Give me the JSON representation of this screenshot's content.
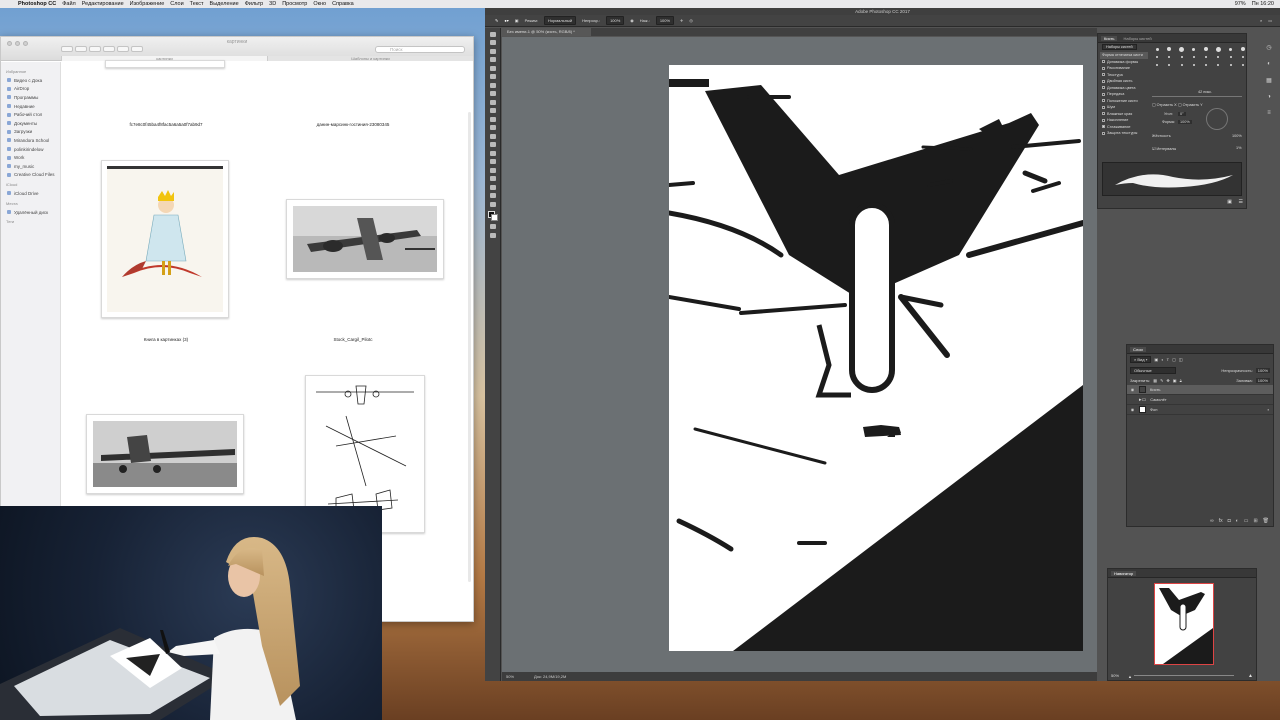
{
  "menubar": {
    "app": "Photoshop CC",
    "items": [
      "Файл",
      "Редактирование",
      "Изображение",
      "Слои",
      "Текст",
      "Выделение",
      "Фильтр",
      "3D",
      "Просмотр",
      "Окно",
      "Справка"
    ],
    "status_right": [
      "97%",
      "Пн 16:20"
    ]
  },
  "finder": {
    "search_placeholder": "Поиск",
    "tabs": [
      "картинки",
      "Шаблоны и картинки"
    ],
    "sidebar": {
      "favorites_label": "Избранное",
      "favorites": [
        "Видео с Дока",
        "AirDrop",
        "Программы",
        "Недавние",
        "Рабочий стол",
        "Документы",
        "Загрузки",
        "Mirandora School",
        "polinkirindelow",
        "Work",
        "my_music",
        "Creative Cloud Files"
      ],
      "icloud_label": "iCloud",
      "icloud": [
        "iCloud Drive"
      ],
      "devices_label": "Места",
      "devices": [
        "Удалённый диск"
      ],
      "tags_label": "Теги"
    },
    "files": [
      {
        "caption": "fc7e8c0f45ba4f8fac5a6a5a0f7ab9d7"
      },
      {
        "caption": "данин-марсинк-гостиния-23080345"
      },
      {
        "caption": "Книга в картинках (3)"
      },
      {
        "caption": "Stock_Cargil_Pilotc"
      }
    ]
  },
  "photoshop": {
    "title": "Adobe Photoshop CC 2017",
    "options": {
      "mode_label": "Режим:",
      "mode_value": "Нормальный",
      "opacity_label": "Непрозр.:",
      "opacity_value": "100%",
      "flow_label": "Наж.:",
      "flow_value": "100%"
    },
    "doc_tab": "Без имени-1 @ 50% (кисть, RGB/8) *",
    "status": {
      "zoom": "50%",
      "doc_size": "Док: 24,9M/19,2M"
    },
    "brush_panel": {
      "tabs": [
        "Кисть",
        "Наборы кистей"
      ],
      "preset_button": "Наборы кистей",
      "options": [
        "Форма отпечатка кисти",
        "Динамика формы",
        "Рассеивание",
        "Текстура",
        "Двойная кисть",
        "Динамика цвета",
        "Передача",
        "Положение кисти",
        "Шум",
        "Влажные края",
        "Накопление",
        "Сглаживание",
        "Защита текстуры"
      ],
      "size_value": "42 пикс.",
      "flip_x": "Отразить X",
      "flip_y": "Отразить Y",
      "angle_label": "Угол:",
      "angle_value": "0°",
      "roundness_label": "Форма:",
      "roundness_value": "100%",
      "hardness_label": "Жёсткость",
      "hardness_value": "100%",
      "spacing_label": "Интервалы",
      "spacing_value": "1%"
    },
    "layers_panel": {
      "title": "Слои",
      "kind_label": "Вид",
      "blend_value": "Обычные",
      "opacity_label": "Непрозрачность:",
      "opacity_value": "100%",
      "lock_label": "Закрепить:",
      "fill_label": "Заливка:",
      "fill_value": "100%",
      "layers": [
        {
          "name": "Кисть",
          "selected": true
        },
        {
          "name": "Самолёт",
          "selected": false
        },
        {
          "name": "Фон",
          "selected": false
        }
      ]
    },
    "navigator": {
      "title": "Навигатор",
      "zoom": "50%"
    }
  }
}
